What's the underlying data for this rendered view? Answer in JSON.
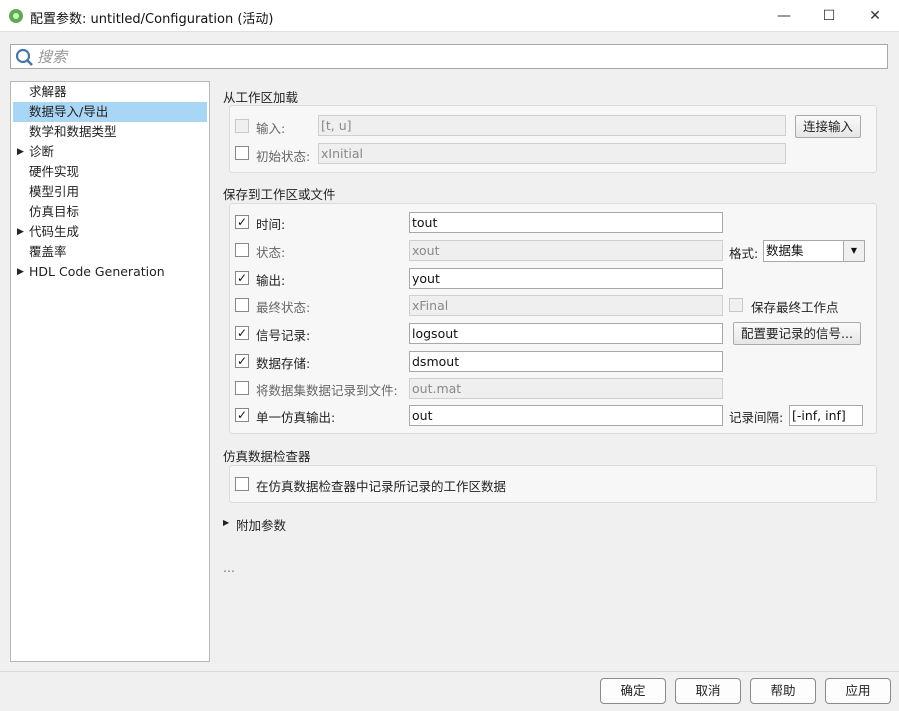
{
  "window": {
    "title": "配置参数: untitled/Configuration (活动)",
    "minimize": "—",
    "maximize": "☐",
    "close": "✕"
  },
  "search": {
    "placeholder": "搜索"
  },
  "tree": [
    {
      "label": "求解器",
      "expandable": false
    },
    {
      "label": "数据导入/导出",
      "expandable": false,
      "selected": true
    },
    {
      "label": "数学和数据类型",
      "expandable": false
    },
    {
      "label": "诊断",
      "expandable": true
    },
    {
      "label": "硬件实现",
      "expandable": false
    },
    {
      "label": "模型引用",
      "expandable": false
    },
    {
      "label": "仿真目标",
      "expandable": false
    },
    {
      "label": "代码生成",
      "expandable": true
    },
    {
      "label": "覆盖率",
      "expandable": false
    },
    {
      "label": "HDL Code Generation",
      "expandable": true
    }
  ],
  "load": {
    "heading": "从工作区加载",
    "input": {
      "label": "输入:",
      "value": "[t, u]",
      "checked": false,
      "button": "连接输入"
    },
    "initial": {
      "label": "初始状态:",
      "value": "xInitial",
      "checked": false
    }
  },
  "save": {
    "heading": "保存到工作区或文件",
    "rows": [
      {
        "label": "时间:",
        "value": "tout",
        "checked": true,
        "enabled": true
      },
      {
        "label": "状态:",
        "value": "xout",
        "checked": false,
        "enabled": false
      },
      {
        "label": "输出:",
        "value": "yout",
        "checked": true,
        "enabled": true
      },
      {
        "label": "最终状态:",
        "value": "xFinal",
        "checked": false,
        "enabled": false
      },
      {
        "label": "信号记录:",
        "value": "logsout",
        "checked": true,
        "enabled": true
      },
      {
        "label": "数据存储:",
        "value": "dsmout",
        "checked": true,
        "enabled": true
      },
      {
        "label": "将数据集数据记录到文件:",
        "value": "out.mat",
        "checked": false,
        "enabled": false
      },
      {
        "label": "单一仿真输出:",
        "value": "out",
        "checked": true,
        "enabled": true
      }
    ],
    "format_label": "格式:",
    "format_value": "数据集",
    "save_final_op": {
      "label": "保存最终工作点",
      "checked": false
    },
    "configure_signals_button": "配置要记录的信号...",
    "interval_label": "记录间隔:",
    "interval_value": "[-inf, inf]"
  },
  "sdi": {
    "heading": "仿真数据检查器",
    "checkbox_label": "在仿真数据检查器中记录所记录的工作区数据",
    "checked": false
  },
  "additional": {
    "label": "附加参数"
  },
  "ellipsis": "...",
  "buttons": {
    "ok": "确定",
    "cancel": "取消",
    "help": "帮助",
    "apply": "应用"
  }
}
